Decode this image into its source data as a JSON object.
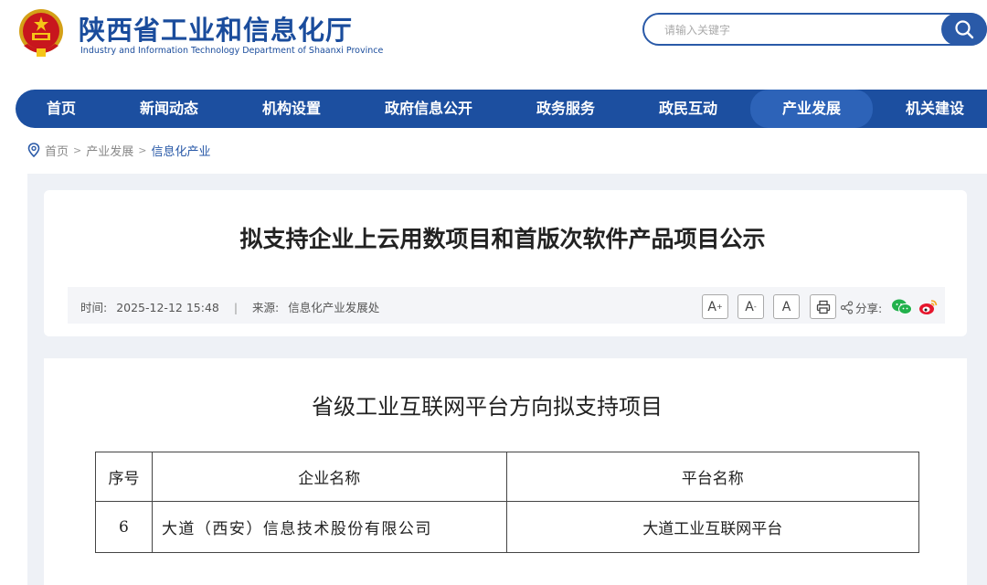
{
  "header": {
    "site_title": "陕西省工业和信息化厅",
    "site_subtitle": "Industry and Information Technology Department of Shaanxi Province",
    "emblem_icon": "national-emblem-icon",
    "search": {
      "placeholder": "请输入关键字",
      "icon": "search-icon"
    }
  },
  "nav": {
    "items": [
      {
        "label": "首页"
      },
      {
        "label": "新闻动态"
      },
      {
        "label": "机构设置"
      },
      {
        "label": "政府信息公开"
      },
      {
        "label": "政务服务"
      },
      {
        "label": "政民互动"
      },
      {
        "label": "产业发展",
        "active": true
      },
      {
        "label": "机关建设"
      }
    ]
  },
  "breadcrumb": {
    "icon": "location-pin-icon",
    "items": [
      "首页",
      "产业发展",
      "信息化产业"
    ],
    "separator": ">"
  },
  "article": {
    "title": "拟支持企业上云用数项目和首版次软件产品项目公示",
    "time_label": "时间:",
    "time_value": "2025-12-12 15:48",
    "divider": "|",
    "source_label": "来源:",
    "source_value": "信息化产业发展处",
    "tools": {
      "font_large": "A",
      "font_small": "A",
      "font_normal": "A",
      "print_icon": "print-icon",
      "share_icon": "share-icon",
      "share_label": "分享:",
      "wechat_icon": "wechat-icon",
      "weibo_icon": "weibo-icon"
    }
  },
  "section": {
    "title": "省级工业互联网平台方向拟支持项目",
    "table": {
      "headers": [
        "序号",
        "企业名称",
        "平台名称"
      ],
      "rows": [
        [
          "6",
          "大道（西安）信息技术股份有限公司",
          "大道工业互联网平台"
        ]
      ]
    }
  },
  "colors": {
    "brand_blue": "#1c4fa0",
    "nav_active": "#2d63b8",
    "panel_bg": "#eef1f6"
  }
}
